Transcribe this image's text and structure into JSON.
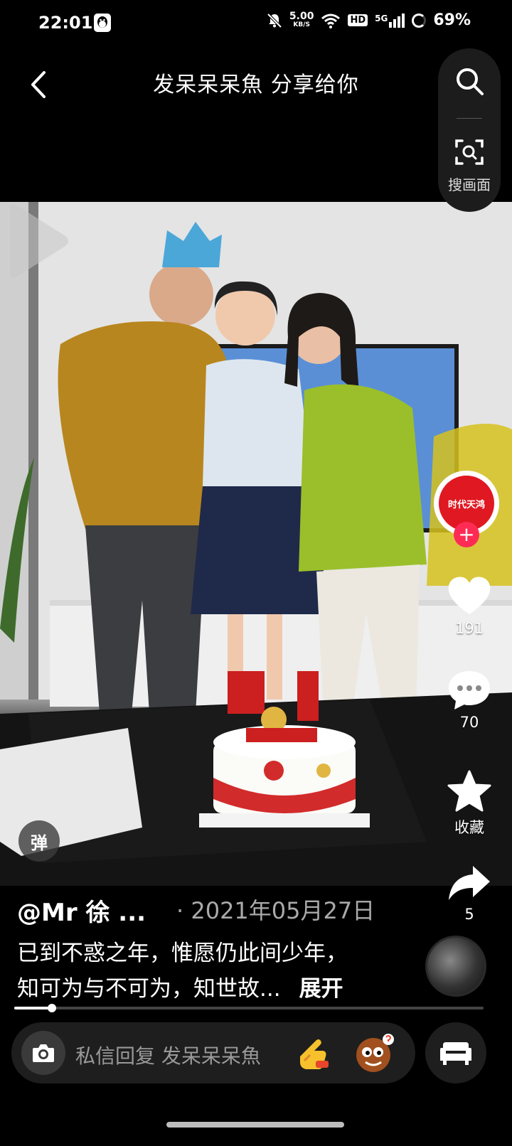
{
  "status_bar": {
    "time": "22:01",
    "net_speed": "5.00",
    "net_unit": "KB/S",
    "hd": "HD",
    "signal": "5G",
    "battery": "69%",
    "icons": [
      "qq-icon",
      "mute-icon",
      "wifi-icon",
      "signal-icon",
      "battery-icon"
    ]
  },
  "header": {
    "title": "发呆呆呆魚 分享给你",
    "scan_label": "搜画面",
    "icons": [
      "back-icon",
      "search-icon",
      "scan-icon"
    ]
  },
  "video": {
    "creator_badge": "时代天鸿",
    "likes": "191",
    "comments": "70",
    "favorites_label": "收藏",
    "shares": "5",
    "danmaku_label": "弹",
    "progress": 0.08
  },
  "info": {
    "author": "@Mr 徐 ...",
    "date": "· 2021年05月27日",
    "desc_line1": "已到不惑之年，惟愿仍此间少年，",
    "desc_line2": "知可为与不可为，知世故...",
    "expand": "展开"
  },
  "input_bar": {
    "placeholder": "私信回复 发呆呆呆魚",
    "icons": [
      "camera-icon",
      "hand-emoji-icon",
      "face-emoji-icon",
      "sofa-icon"
    ]
  },
  "colors": {
    "accent": "#fe2c55",
    "background": "#000000",
    "badge_red": "#e01822"
  }
}
